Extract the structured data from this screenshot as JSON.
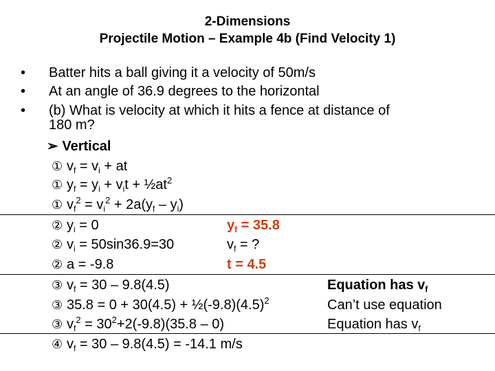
{
  "title": {
    "line1": "2-Dimensions",
    "line2": "Projectile Motion – Example 4b (Find Velocity 1)"
  },
  "bullets": [
    {
      "marker": "•",
      "text": "Batter hits a ball giving it a velocity of 50m/s"
    },
    {
      "marker": "•",
      "text": "At an angle of 36.9 degrees to the horizontal"
    },
    {
      "marker": "•",
      "text": "(b)  What is velocity at which it hits a fence at distance of",
      "text_cont": "180 m?"
    }
  ],
  "section": {
    "marker": "➢",
    "label": "Vertical"
  },
  "steps": {
    "s1": "①",
    "s2": "②",
    "s3": "③",
    "s4": "④"
  },
  "eq": {
    "vf": "v",
    "f": "f",
    "i": "i",
    "y": "y",
    "sq": "2",
    "e1_rest": " = v",
    "e1_tail": " + at",
    "e2_mid": " = y",
    "e2_mid2": " + v",
    "e2_tail": "t + ½at",
    "e3_mid": " = v",
    "e3_mid2": " + 2a(y",
    "e3_mid3": " – y",
    "e3_tail": ")"
  },
  "given": {
    "yi": " = 0",
    "vi": " = 50sin36.9=30",
    "a": "a = -9.8",
    "yf": " = 35.8",
    "vf": " = ?",
    "t": "t = 4.5"
  },
  "solve": {
    "r1": " = 30 – 9.8(4.5)",
    "r2": "35.8 = 0 + 30(4.5) + ½(-9.8)(4.5)",
    "r3a": " = 30",
    "r3b": "+2(-9.8)(35.8 – 0)",
    "r4": " = 30 – 9.8(4.5) = -14.1 m/s"
  },
  "notes": {
    "n1": "Equation has v",
    "n2": "Can’t use equation",
    "n3": "Equation has v"
  },
  "colors": {
    "highlight": "#cf3d12"
  }
}
